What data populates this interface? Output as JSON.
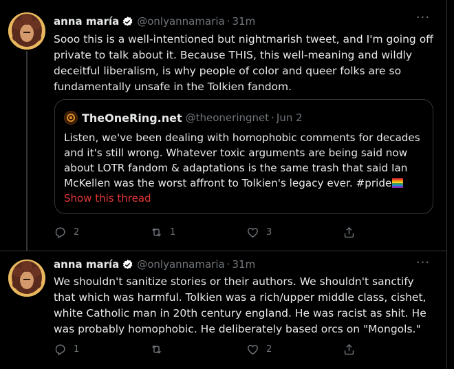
{
  "tweets": [
    {
      "name": "anna maría",
      "handle": "@onlyannamaria",
      "separator": "·",
      "time": "31m",
      "more": "···",
      "text": "Sooo this is a well-intentioned but nightmarish tweet, and I'm going off private to talk about it. Because THIS, this well-meaning and wildly deceitful liberalism, is why people of color and queer folks are so fundamentally unsafe in the Tolkien fandom.",
      "quote": {
        "name": "TheOneRing.net",
        "handle": "@theoneringnet",
        "separator": "·",
        "date": "Jun 2",
        "text": "Listen, we've been dealing with homophobic comments for decades and it's still wrong. Whatever toxic arguments are being said now about LOTR fandom & adaptations is the same trash that said Ian McKellen was the worst affront to Tolkien's legacy ever.  #pride",
        "link": "Show this thread"
      },
      "actions": {
        "replies": "2",
        "retweets": "1",
        "likes": "3",
        "share": ""
      },
      "icons": [
        "reply-icon",
        "retweet-icon",
        "like-icon",
        "share-icon"
      ]
    },
    {
      "name": "anna maría",
      "handle": "@onlyannamaria",
      "separator": "·",
      "time": "31m",
      "more": "···",
      "text": "We shouldn't sanitize stories or their authors. We shouldn't sanctify that which was harmful. Tolkien was a rich/upper middle class, cishet, white Catholic man in 20th century england. He was racist as shit. He was probably homophobic. He deliberately based orcs on \"Mongols.\"",
      "actions": {
        "replies": "1",
        "retweets": "",
        "likes": "2",
        "share": ""
      },
      "icons": [
        "reply-icon",
        "retweet-icon",
        "like-icon",
        "share-icon"
      ]
    }
  ],
  "colors": {
    "background": "#000000",
    "text": "#e7e9ea",
    "muted": "#71767b",
    "verified": "#ffffff",
    "show_thread": "#e23636",
    "border": "#2f3336"
  }
}
